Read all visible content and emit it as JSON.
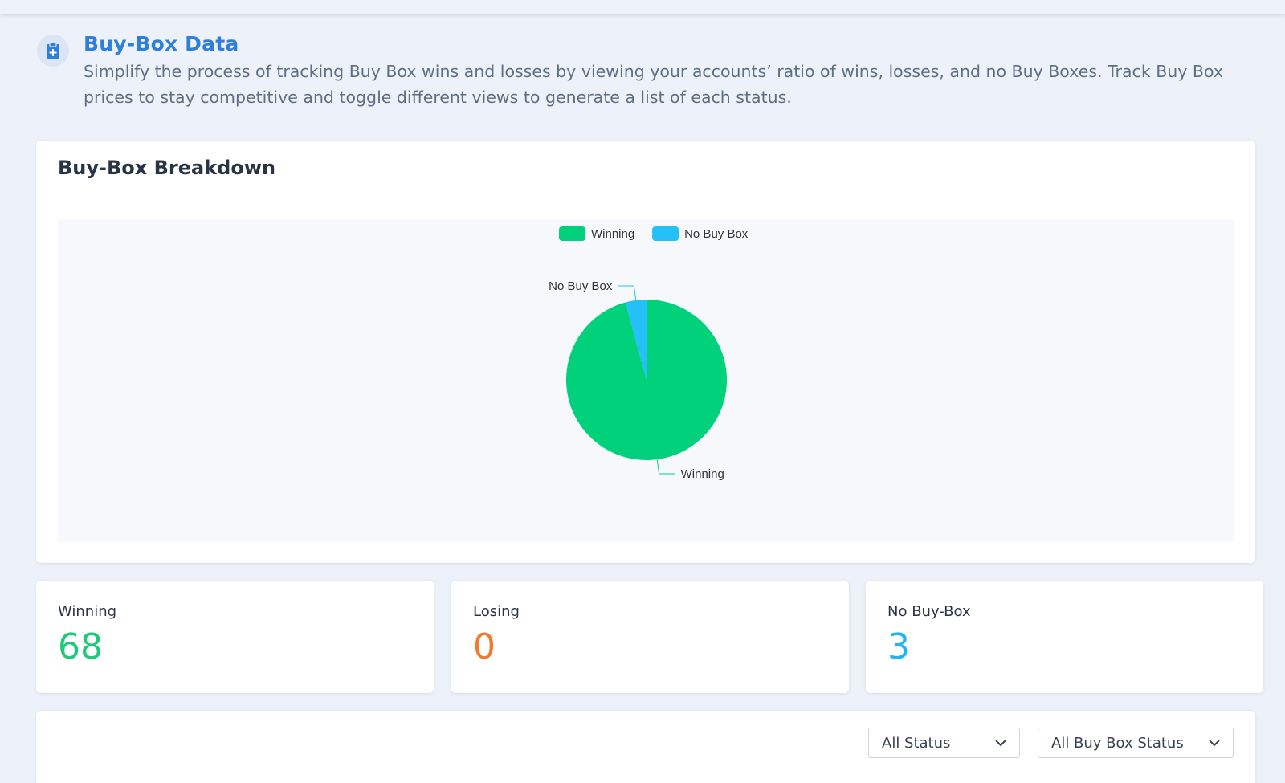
{
  "header": {
    "icon": "clipboard-plus-icon",
    "title": "Buy-Box Data",
    "description": "Simplify the process of tracking Buy Box wins and losses by viewing your accounts’ ratio of wins, losses, and no Buy Boxes. Track Buy Box prices to stay competitive and toggle different views to generate a list of each status."
  },
  "breakdown": {
    "title": "Buy-Box Breakdown"
  },
  "chart_data": {
    "type": "pie",
    "title": "",
    "categories": [
      "Winning",
      "No Buy Box"
    ],
    "values": [
      68,
      3
    ],
    "colors": [
      "#02d17b",
      "#24c0f7"
    ],
    "legend": [
      "Winning",
      "No Buy Box"
    ],
    "legend_position": "top",
    "slice_labels": [
      "Winning",
      "No Buy Box"
    ]
  },
  "stats": [
    {
      "label": "Winning",
      "value": "68",
      "color": "#1ec97b"
    },
    {
      "label": "Losing",
      "value": "0",
      "color": "#f07a2e"
    },
    {
      "label": "No Buy-Box",
      "value": "3",
      "color": "#20b4f2"
    }
  ],
  "filters": {
    "status": {
      "selected": "All Status",
      "icon": "chevron-down-icon"
    },
    "buybox_status": {
      "selected": "All Buy Box Status",
      "icon": "chevron-down-icon"
    }
  }
}
